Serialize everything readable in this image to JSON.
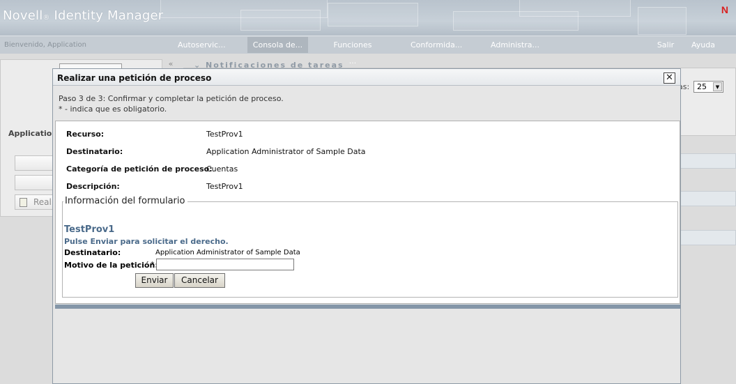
{
  "header": {
    "brand": "Novell",
    "brand_mark": "®",
    "brand_product": "Identity Manager",
    "logo_letter": "N"
  },
  "nav": {
    "welcome": "Bienvenido, Application",
    "tabs": [
      {
        "label": "Autoservic..."
      },
      {
        "label": "Consola de...",
        "active": true
      },
      {
        "label": "Funciones ..."
      },
      {
        "label": "Conformida..."
      },
      {
        "label": "Administra..."
      }
    ],
    "logout": "Salir",
    "help": "Ayuda"
  },
  "background": {
    "left_user": "Application",
    "left_button_partial": "Reali",
    "collapse_glyph": "«",
    "notifications_title": "Notificaciones de tareas",
    "per_page_label_partial": "as:",
    "per_page_value": "25"
  },
  "modal": {
    "title": "Realizar una petición de proceso",
    "close_glyph": "✕",
    "step": "Paso 3 de 3: Confirmar y completar la petición de proceso.",
    "required_note": "* - indica que es obligatorio.",
    "summary": [
      {
        "label": "Recurso:",
        "value": "TestProv1"
      },
      {
        "label": "Destinatario:",
        "value": "Application Administrator of Sample Data"
      },
      {
        "label": "Categoría de petición de proceso:",
        "value": "Cuentas"
      },
      {
        "label": "Descripción:",
        "value": "TestProv1"
      }
    ],
    "form": {
      "legend": "Información del formulario",
      "title": "TestProv1",
      "instruction": "Pulse Enviar para solicitar el derecho.",
      "recipient_label": "Destinatario:",
      "recipient_value": "Application Administrator of Sample Data",
      "reason_label": "Motivo de la petición:",
      "required_mark": "*",
      "reason_value": "",
      "submit_label": "Enviar",
      "cancel_label": "Cancelar"
    }
  },
  "colors": {
    "brand_red": "#d9201f",
    "form_heading": "#4a6a8a",
    "modal_bar": "#8496a8"
  }
}
